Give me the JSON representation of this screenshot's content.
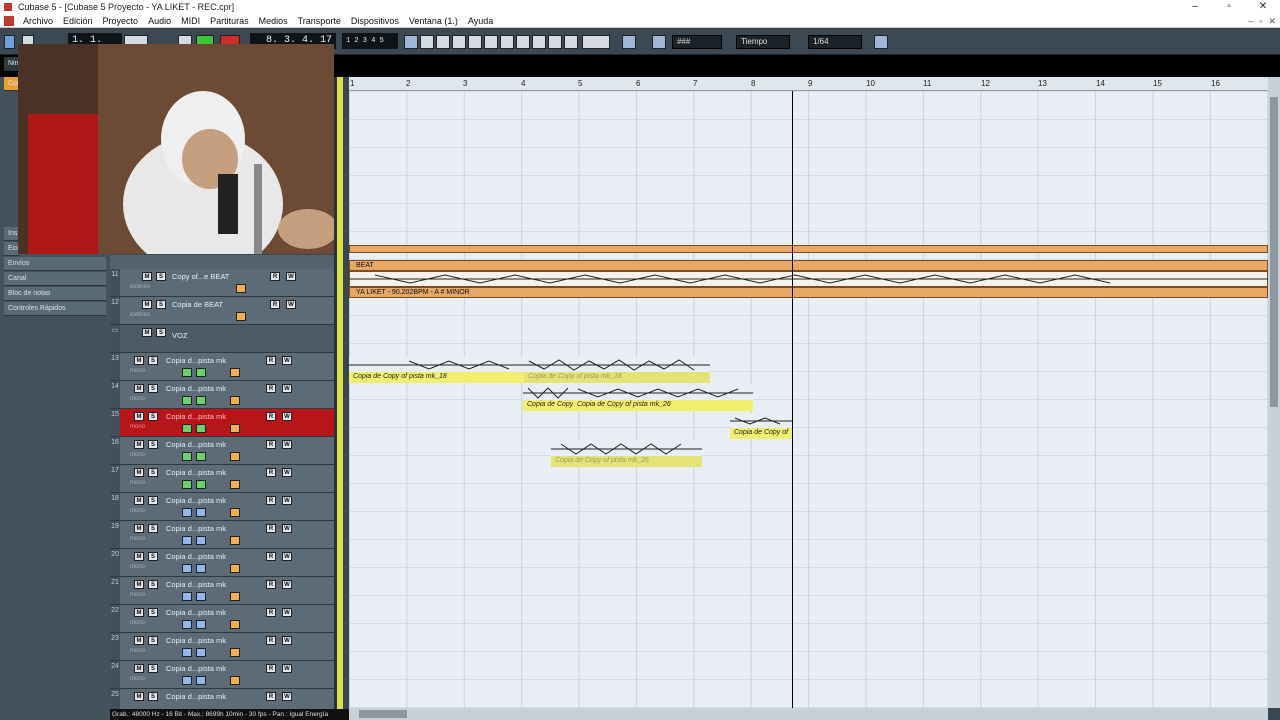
{
  "window": {
    "title": "Cubase 5 - [Cubase 5 Proyecto - YA LIKET - REC.cpr]"
  },
  "menu": [
    "Archivo",
    "Edición",
    "Proyecto",
    "Audio",
    "MIDI",
    "Partituras",
    "Medios",
    "Transporte",
    "Dispositivos",
    "Ventana (1.)",
    "Ayuda"
  ],
  "toolbar": {
    "position_left": "1. 1. 1.  0",
    "position_right": "8. 3. 4. 17",
    "grid_type": "Tiempo",
    "quantize": "1/64"
  },
  "inspector": {
    "items": [
      "Envíos",
      "Canal",
      "Bloc de notas",
      "Controles Rápidos"
    ],
    "truncated_labels": [
      "Nin",
      "Cop",
      "Ins",
      "Ecu"
    ]
  },
  "ruler": {
    "marks": [
      "1",
      "2",
      "3",
      "4",
      "5",
      "6",
      "7",
      "8",
      "9",
      "10",
      "11",
      "12",
      "13",
      "14",
      "15",
      "16"
    ]
  },
  "tracks": [
    {
      "num": "11",
      "name": "Copy of...e BEAT",
      "sub": "estéreo",
      "selected": false
    },
    {
      "num": "12",
      "name": "Copia de BEAT",
      "sub": "estéreo",
      "selected": false
    },
    {
      "num": "",
      "name": "VOZ",
      "sub": "",
      "selected": false
    },
    {
      "num": "13",
      "name": "Copia d...pista mk",
      "sub": "mono",
      "selected": false
    },
    {
      "num": "14",
      "name": "Copia d...pista mk",
      "sub": "mono",
      "selected": false
    },
    {
      "num": "15",
      "name": "Copia d...pista mk",
      "sub": "mono",
      "selected": true
    },
    {
      "num": "16",
      "name": "Copia d...pista mk",
      "sub": "mono",
      "selected": false
    },
    {
      "num": "17",
      "name": "Copia d...pista mk",
      "sub": "mono",
      "selected": false
    },
    {
      "num": "18",
      "name": "Copia d...pista mk",
      "sub": "mono",
      "selected": false
    },
    {
      "num": "19",
      "name": "Copia d...pista mk",
      "sub": "mono",
      "selected": false
    },
    {
      "num": "20",
      "name": "Copia d...pista mk",
      "sub": "mono",
      "selected": false
    },
    {
      "num": "21",
      "name": "Copia d...pista mk",
      "sub": "mono",
      "selected": false
    },
    {
      "num": "22",
      "name": "Copia d...pista mk",
      "sub": "mono",
      "selected": false
    },
    {
      "num": "23",
      "name": "Copia d...pista mk",
      "sub": "mono",
      "selected": false
    },
    {
      "num": "24",
      "name": "Copia d...pista mk",
      "sub": "mono",
      "selected": false
    },
    {
      "num": "25",
      "name": "Copia d...pista mk",
      "sub": "mono",
      "selected": false
    }
  ],
  "events": {
    "beat_label": "BEAT",
    "info_label": "YA LIKET - 90.202BPM -  A # MINOR",
    "e1": "Copia de Copy of pista mk_18",
    "e2": "Copia de Copy of pista mk_18",
    "e3": "Copia de Copy",
    "e4": "Copia de Copy of pista mk_26",
    "e5": "Copia de Copy of",
    "e6": "Copia de Copy of pista mk_26"
  },
  "status": "Grab.: 48000 Hz - 16 Bit - Max.: 8699h 10min - 30 fps - Pan : Igual Energía",
  "colors": {
    "accent": "#b8141c",
    "event_yellow": "#f1ef8a",
    "beat_orange": "#e9a765"
  }
}
